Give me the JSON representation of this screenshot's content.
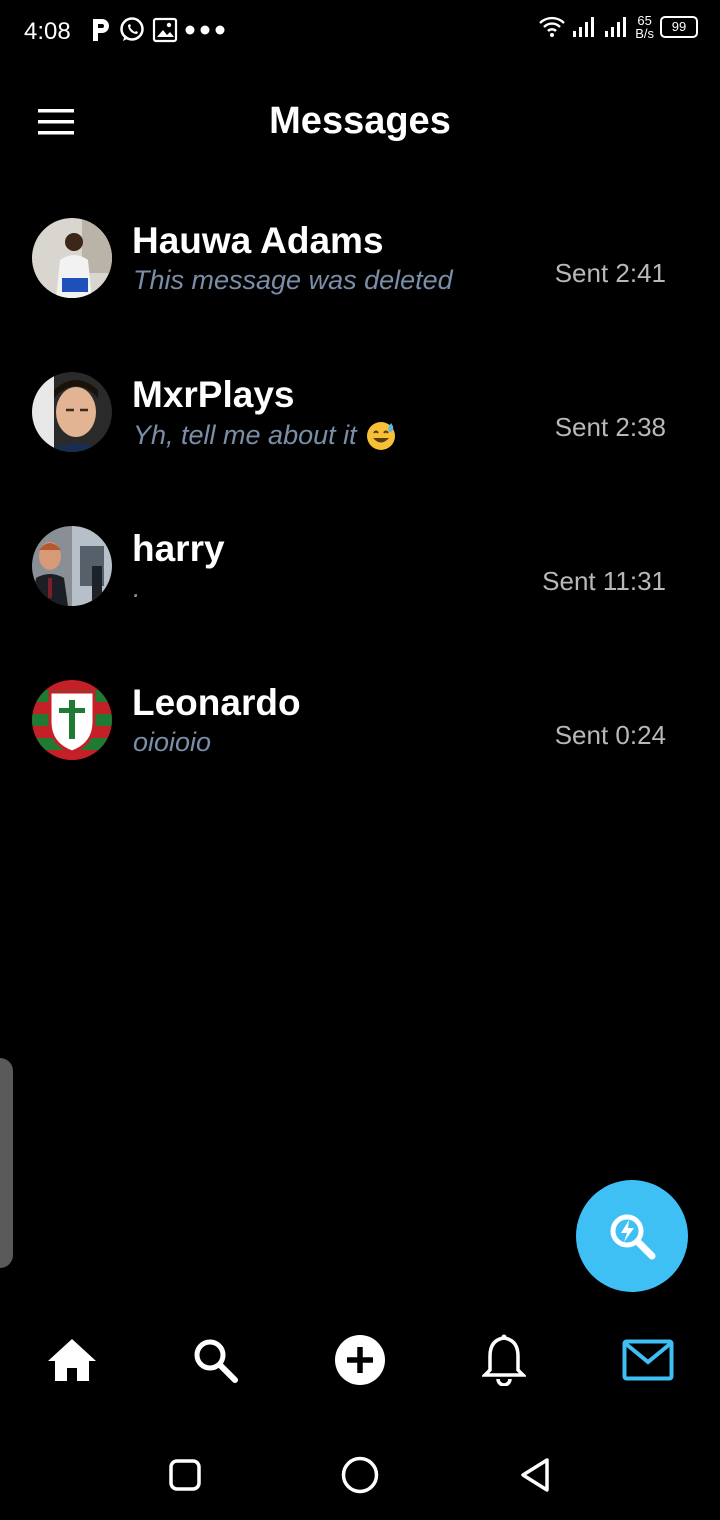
{
  "status_bar": {
    "time": "4:08",
    "speed_value": "65",
    "speed_unit": "B/s",
    "battery": "99",
    "left_icons": [
      "p-icon",
      "whatsapp-icon",
      "image-icon",
      "more-dots-icon"
    ],
    "right_icons": [
      "wifi-icon",
      "signal-icon",
      "signal-icon"
    ]
  },
  "header": {
    "title": "Messages"
  },
  "conversations": [
    {
      "name": "Hauwa Adams",
      "preview": "This message was deleted",
      "sent": "Sent  2:41"
    },
    {
      "name": "MxrPlays",
      "preview": "Yh, tell me about it",
      "emoji": "😅",
      "sent": "Sent  2:38"
    },
    {
      "name": "harry",
      "preview": ".",
      "sent": "Sent  11:31"
    },
    {
      "name": "Leonardo",
      "preview": "oioioio",
      "sent": "Sent  0:24"
    }
  ],
  "fab": {
    "icon": "lightning-search-icon",
    "color": "#3fc0f5"
  },
  "bottom_nav": [
    "home-icon",
    "search-icon",
    "add-circle-icon",
    "bell-icon",
    "mail-icon"
  ],
  "accent": "#3fc0f5"
}
